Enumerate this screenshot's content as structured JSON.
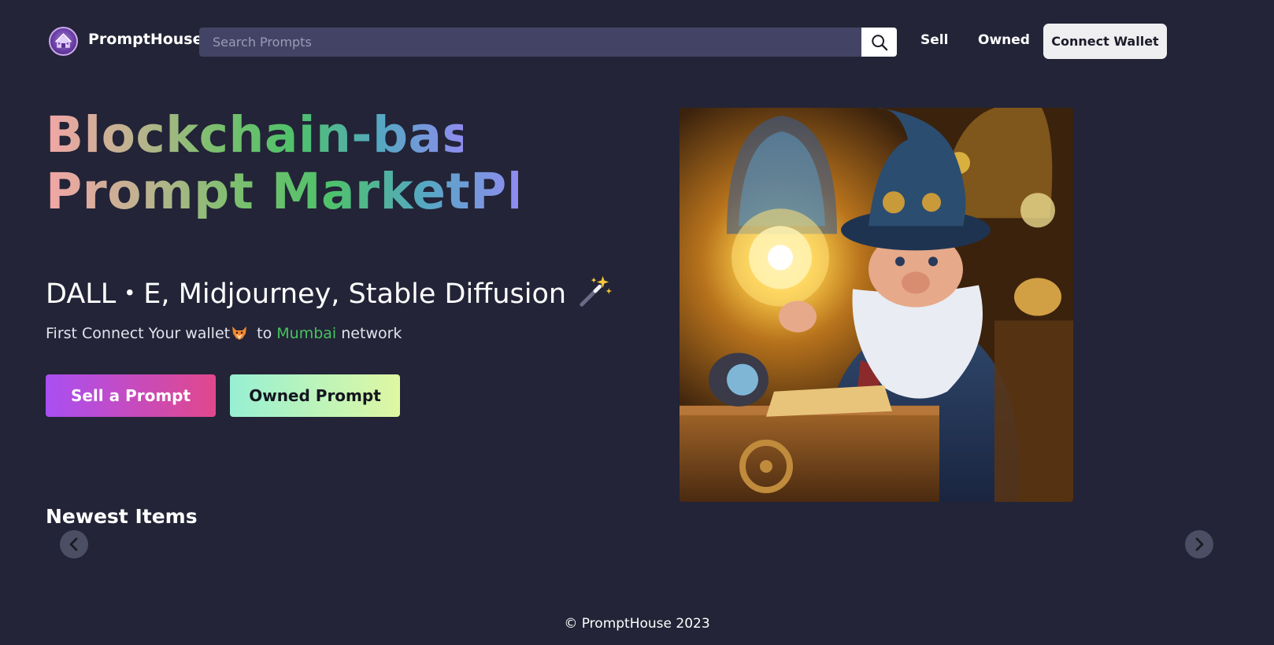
{
  "header": {
    "brand": "PromptHouse",
    "search_placeholder": "Search Prompts",
    "links": {
      "sell": "Sell",
      "owned": "Owned"
    },
    "connect_wallet": "Connect Wallet"
  },
  "hero": {
    "title_line1": "Blockchain-based",
    "title_line2": "Prompt MarketPlace",
    "models": "DALL・E, Midjourney, Stable Diffusion",
    "subtitle_prefix": "First Connect Your wallet",
    "subtitle_to": "to",
    "network_name": "Mumbai",
    "subtitle_suffix": "network",
    "sell_button": "Sell a Prompt",
    "owned_button": "Owned Prompt"
  },
  "newest": {
    "heading": "Newest Items"
  },
  "footer": {
    "copyright": "© PromptHouse 2023"
  },
  "colors": {
    "background": "#232437",
    "search_bg": "#434465",
    "network": "#47c25f",
    "sell_gradient": [
      "#a94ff3",
      "#e1488c"
    ],
    "owned_gradient": [
      "#97f0d3",
      "#dff7a2"
    ]
  },
  "icons": [
    "house-logo-icon",
    "search-icon",
    "magic-wand-icon",
    "fox-icon",
    "chevron-left-icon",
    "chevron-right-icon"
  ]
}
